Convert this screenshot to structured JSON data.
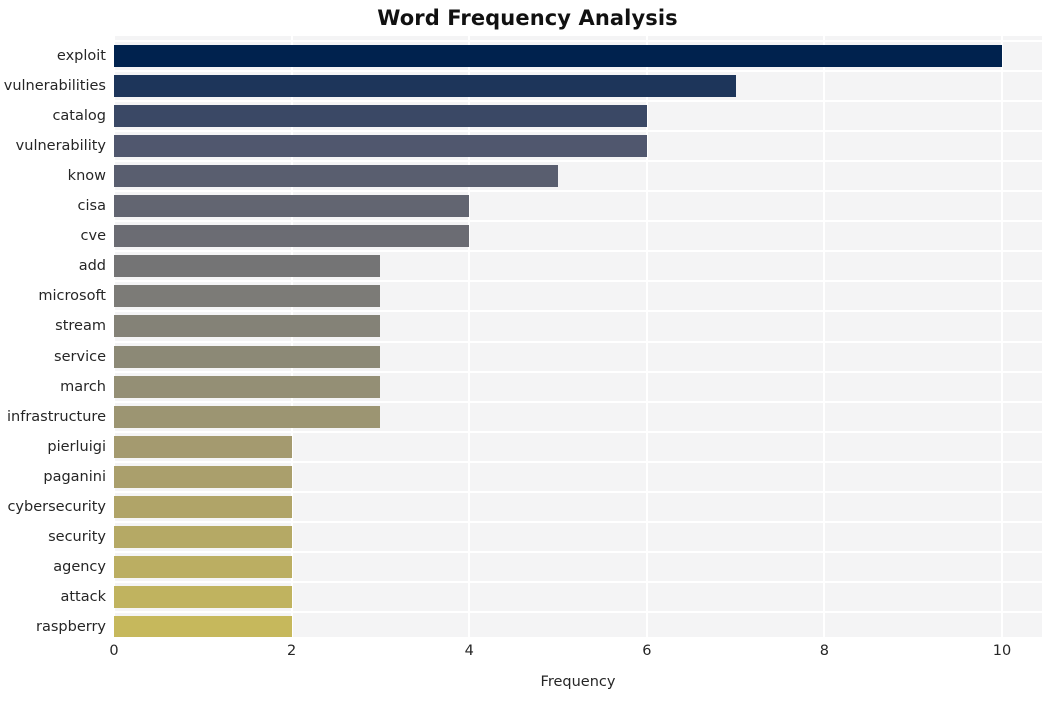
{
  "chart_data": {
    "type": "bar",
    "orientation": "horizontal",
    "title": "Word Frequency Analysis",
    "xlabel": "Frequency",
    "ylabel": "",
    "categories": [
      "exploit",
      "vulnerabilities",
      "catalog",
      "vulnerability",
      "know",
      "cisa",
      "cve",
      "add",
      "microsoft",
      "stream",
      "service",
      "march",
      "infrastructure",
      "pierluigi",
      "paganini",
      "cybersecurity",
      "security",
      "agency",
      "attack",
      "raspberry"
    ],
    "values": [
      10,
      7,
      6,
      6,
      5,
      4,
      4,
      3,
      3,
      3,
      3,
      3,
      3,
      2,
      2,
      2,
      2,
      2,
      2,
      2
    ],
    "bar_colors": [
      "#00224e",
      "#4d556d",
      "#656771",
      "#676873",
      "#7c7b77",
      "#918d76",
      "#938f77",
      "#aea066",
      "#aea066",
      "#aea066",
      "#aea066",
      "#aea066",
      "#aea066",
      "#c6b póź"
    ],
    "xticks": [
      0,
      2,
      4,
      6,
      8,
      10
    ],
    "xtick_labels": [
      "0",
      "2",
      "4",
      "6",
      "8",
      "10"
    ],
    "xlim": [
      0,
      10.45
    ],
    "grid": true,
    "legend": false,
    "plot_background": "#f4f4f5",
    "gridline_color": "#ffffff",
    "title_color": "#111111",
    "tick_color": "#262626"
  }
}
